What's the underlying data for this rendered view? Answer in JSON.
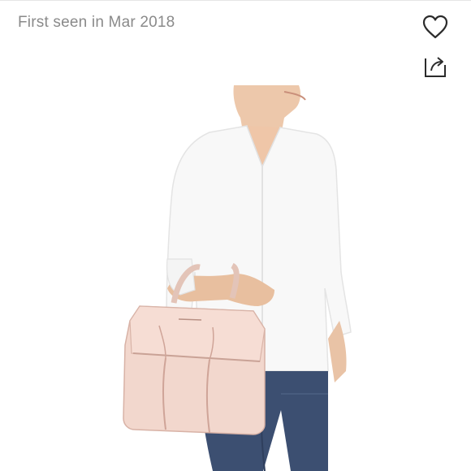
{
  "listing": {
    "first_seen_text": "First seen in Mar 2018"
  },
  "actions": {
    "like_icon": "heart-outline-icon",
    "share_icon": "share-arrow-icon"
  },
  "photo": {
    "subject": "product-photo",
    "colors": {
      "background": "#ffffff",
      "blouse": "#f7f7f7",
      "skin": "#e9c3a6",
      "jeans": "#3c4f71",
      "bag": "#f1d6cc",
      "bag_edge": "#d8b2a6"
    }
  }
}
